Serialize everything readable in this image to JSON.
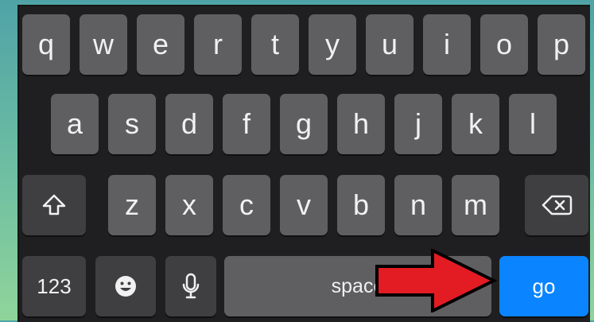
{
  "keyboard": {
    "row1": [
      "q",
      "w",
      "e",
      "r",
      "t",
      "y",
      "u",
      "i",
      "o",
      "p"
    ],
    "row2": [
      "a",
      "s",
      "d",
      "f",
      "g",
      "h",
      "j",
      "k",
      "l"
    ],
    "row3": [
      "z",
      "x",
      "c",
      "v",
      "b",
      "n",
      "m"
    ],
    "bottom": {
      "numbers_label": "123",
      "space_label": "space",
      "go_label": "go"
    }
  },
  "icons": {
    "shift": "shift-icon",
    "delete": "delete-icon",
    "emoji": "emoji-icon",
    "mic": "microphone-icon",
    "annotation": "red-arrow-icon"
  },
  "colors": {
    "go_button": "#0a84ff",
    "arrow": "#e31b23"
  }
}
